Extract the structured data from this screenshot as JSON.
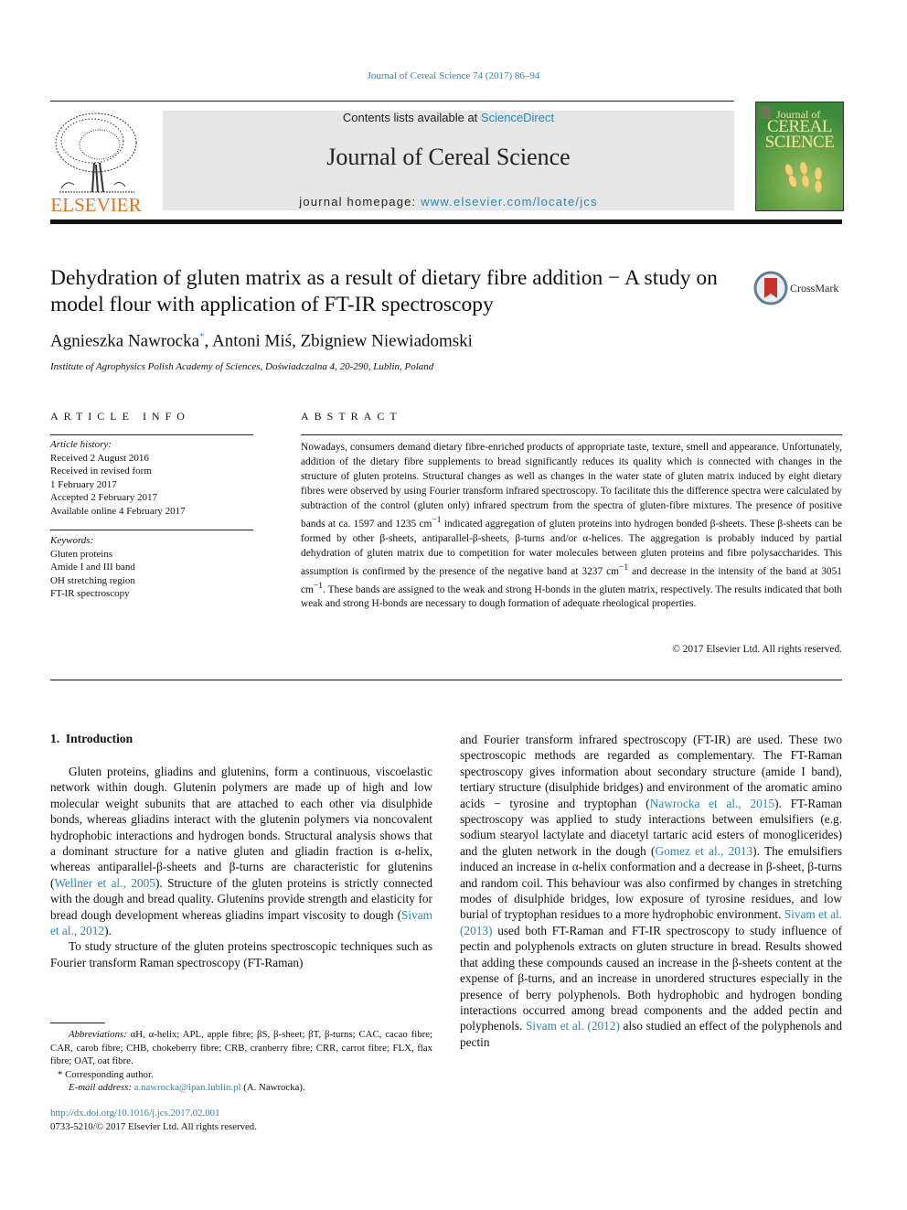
{
  "header": {
    "citation": "Journal of Cereal Science 74 (2017) 86–94",
    "contents_prefix": "Contents lists available at ",
    "contents_link": "ScienceDirect",
    "journal_title": "Journal of Cereal Science",
    "homepage_prefix": "journal homepage: ",
    "homepage_link": "www.elsevier.com/locate/jcs",
    "publisher_logo_text": "ELSEVIER",
    "cover": {
      "line1": "Journal of",
      "line2": "CEREAL",
      "line3": "SCIENCE"
    }
  },
  "article": {
    "title": "Dehydration of gluten matrix as a result of dietary fibre addition − A study on model flour with application of FT-IR spectroscopy",
    "crossmark_label": "CrossMark",
    "authors": [
      {
        "name": "Agnieszka Nawrocka",
        "mark": "*"
      },
      {
        "name": "Antoni Miś"
      },
      {
        "name": "Zbigniew Niewiadomski"
      }
    ],
    "author_sep": ", ",
    "affiliation": "Institute of Agrophysics Polish Academy of Sciences, Doświadczalna 4, 20-290, Lublin, Poland"
  },
  "article_info": {
    "heading": "ARTICLE INFO",
    "history_label": "Article history:",
    "history": [
      "Received 2 August 2016",
      "Received in revised form",
      "1 February 2017",
      "Accepted 2 February 2017",
      "Available online 4 February 2017"
    ],
    "keywords_label": "Keywords:",
    "keywords": [
      "Gluten proteins",
      "Amide I and III band",
      "OH stretching region",
      "FT-IR spectroscopy"
    ]
  },
  "abstract": {
    "heading": "ABSTRACT",
    "text_1": "Nowadays, consumers demand dietary fibre-enriched products of appropriate taste, texture, smell and appearance. Unfortunately, addition of the dietary fibre supplements to bread significantly reduces its quality which is connected with changes in the structure of gluten proteins. Structural changes as well as changes in the water state of gluten matrix induced by eight dietary fibres were observed by using Fourier transform infrared spectroscopy. To facilitate this the difference spectra were calculated by subtraction of the control (gluten only) infrared spectrum from the spectra of gluten-fibre mixtures. The presence of positive bands at ca. 1597 and 1235 cm",
    "sup": "−1",
    "text_2": " indicated aggregation of gluten proteins into hydrogen bonded β-sheets. These β-sheets can be formed by other β-sheets, antiparallel-β-sheets, β-turns and/or α-helices. The aggregation is probably induced by partial dehydration of gluten matrix due to competition for water molecules between gluten proteins and fibre polysaccharides. This assumption is confirmed by the presence of the negative band at 3237 cm",
    "text_3": " and decrease in the intensity of the band at 3051 cm",
    "text_4": ". These bands are assigned to the weak and strong H-bonds in the gluten matrix, respectively. The results indicated that both weak and strong H-bonds are necessary to dough formation of adequate rheological properties.",
    "copyright": "© 2017 Elsevier Ltd. All rights reserved."
  },
  "body": {
    "section_number": "1.",
    "section_title": "Introduction",
    "left_p1_a": "Gluten proteins, gliadins and glutenins, form a continuous, viscoelastic network within dough. Glutenin polymers are made up of high and low molecular weight subunits that are attached to each other via disulphide bonds, whereas gliadins interact with the glutenin polymers via noncovalent hydrophobic interactions and hydrogen bonds. Structural analysis shows that a dominant structure for a native gluten and gliadin fraction is α-helix, whereas antiparallel-β-sheets and β-turns are characteristic for glutenins (",
    "ref_wellner": "Wellner et al., 2005",
    "left_p1_b": "). Structure of the gluten proteins is strictly connected with the dough and bread quality. Glutenins provide strength and elasticity for bread dough development whereas gliadins impart viscosity to dough (",
    "ref_sivam2012a": "Sivam et al., 2012",
    "left_p1_c": ").",
    "left_p2": "To study structure of the gluten proteins spectroscopic techniques such as Fourier transform Raman spectroscopy (FT-Raman)",
    "right_a": "and Fourier transform infrared spectroscopy (FT-IR) are used. These two spectroscopic methods are regarded as complementary. The FT-Raman spectroscopy gives information about secondary structure (amide I band), tertiary structure (disulphide bridges) and environment of the aromatic amino acids − tyrosine and tryptophan (",
    "ref_nawrocka": "Nawrocka et al., 2015",
    "right_b": "). FT-Raman spectroscopy was applied to study interactions between emulsifiers (e.g. sodium stearyol lactylate and diacetyl tartaric acid esters of monoglicerides) and the gluten network in the dough (",
    "ref_gomez": "Gomez et al., 2013",
    "right_c": "). The emulsifiers induced an increase in α-helix conformation and a decrease in β-sheet, β-turns and random coil. This behaviour was also confirmed by changes in stretching modes of disulphide bridges, low exposure of tyrosine residues, and low burial of tryptophan residues to a more hydrophobic environment. ",
    "ref_sivam2013": "Sivam et al. (2013)",
    "right_d": " used both FT-Raman and FT-IR spectroscopy to study influence of pectin and polyphenols extracts on gluten structure in bread. Results showed that adding these compounds caused an increase in the β-sheets content at the expense of β-turns, and an increase in unordered structures especially in the presence of berry polyphenols. Both hydrophobic and hydrogen bonding interactions occurred among bread components and the added pectin and polyphenols. ",
    "ref_sivam2012b": "Sivam et al. (2012)",
    "right_e": " also studied an effect of the polyphenols and pectin"
  },
  "footnotes": {
    "abbrev_label": "Abbreviations:",
    "abbrev_text": " αH, α-helix; APL, apple fibre; βS, β-sheet; βT, β-turns; CAC, cacao fibre; CAR, carob fibre; CHB, chokeberry fibre; CRB, cranberry fibre; CRR, carrot fibre; FLX, flax fibre; OAT, oat fibre.",
    "corresponding": "* Corresponding author.",
    "email_label": "E-mail address:",
    "email": "a.nawrocka@ipan.lublin.pl",
    "email_suffix": " (A. Nawrocka).",
    "doi": "http://dx.doi.org/10.1016/j.jcs.2017.02.001",
    "issn": "0733-5210/© 2017 Elsevier Ltd. All rights reserved."
  }
}
